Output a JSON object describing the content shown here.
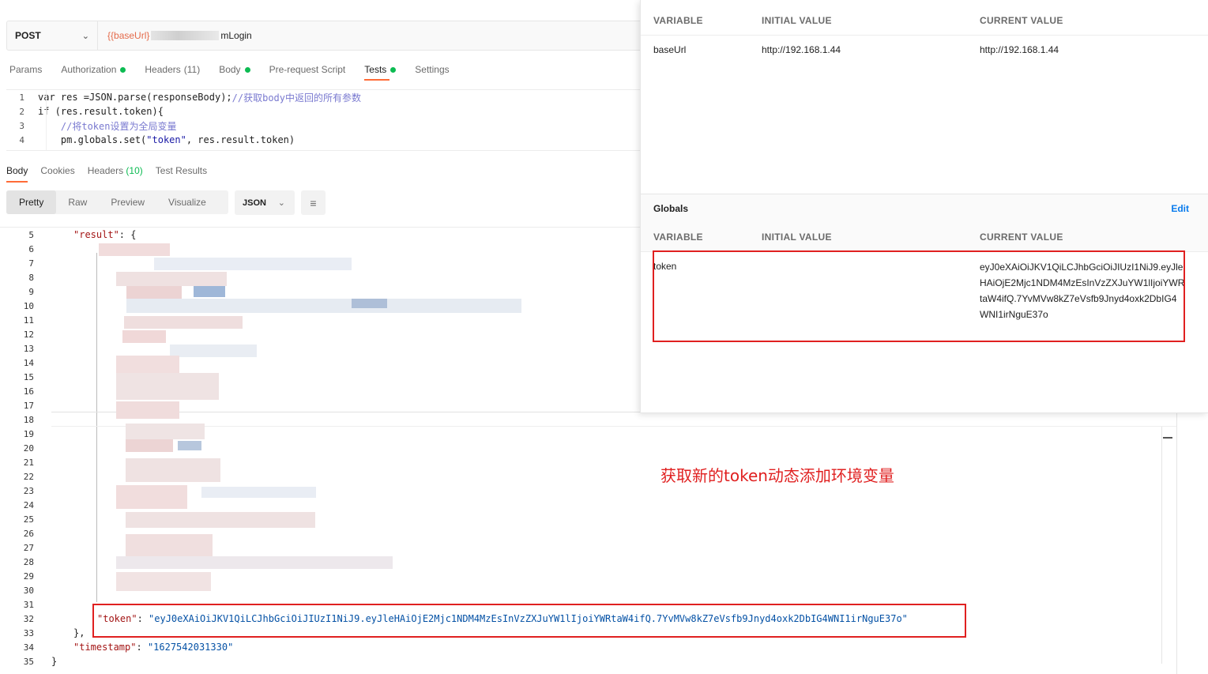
{
  "request": {
    "method": "POST",
    "url_var": "{{baseUrl}",
    "url_path": "mLogin"
  },
  "request_tabs": [
    {
      "label": "Params"
    },
    {
      "label": "Authorization"
    },
    {
      "label": "Headers",
      "count": "(11)"
    },
    {
      "label": "Body"
    },
    {
      "label": "Pre-request Script"
    },
    {
      "label": "Tests"
    },
    {
      "label": "Settings"
    }
  ],
  "tests_script": {
    "line_numbers": [
      "1",
      "2",
      "3",
      "4"
    ],
    "line1_a": "var res =JSON.parse(responseBody);",
    "line1_b": "//获取body中返回的所有参数",
    "line2": "if (res.result.token){",
    "line3": "    //将token设置为全局变量",
    "line4_a": "    pm.globals.set(",
    "line4_b": "\"token\"",
    "line4_c": ", res.result.token)"
  },
  "response_tabs": [
    {
      "label": "Body"
    },
    {
      "label": "Cookies"
    },
    {
      "label": "Headers",
      "count": "(10)"
    },
    {
      "label": "Test Results"
    }
  ],
  "view_modes": [
    "Pretty",
    "Raw",
    "Preview",
    "Visualize"
  ],
  "format": "JSON",
  "response_body": {
    "line_numbers": [
      "5",
      "6",
      "7",
      "8",
      "9",
      "10",
      "11",
      "12",
      "13",
      "14",
      "15",
      "16",
      "17",
      "18",
      "19",
      "20",
      "21",
      "22",
      "23",
      "24",
      "25",
      "26",
      "27",
      "28",
      "29",
      "30",
      "31",
      "32",
      "33",
      "34",
      "35"
    ],
    "result_key": "\"result\"",
    "result_open": ": {",
    "token_key": "\"token\"",
    "token_sep": ": ",
    "token_value": "\"eyJ0eXAiOiJKV1QiLCJhbGciOiJIUzI1NiJ9.eyJleHAiOjE2Mjc1NDM4MzEsInVzZXJuYW1lIjoiYWRtaW4ifQ.7YvMVw8kZ7eVsfb9Jnyd4oxk2DbIG4WNI1irNguE37o\"",
    "close_result": "},",
    "timestamp_key": "\"timestamp\"",
    "timestamp_sep": ": ",
    "timestamp_value": "\"1627542031330\"",
    "close_root": "}"
  },
  "environment": {
    "headers": {
      "variable": "VARIABLE",
      "initial": "INITIAL VALUE",
      "current": "CURRENT VALUE"
    },
    "rows": [
      {
        "variable": "baseUrl",
        "initial": "http://192.168.1.44",
        "current": "http://192.168.1.44"
      }
    ]
  },
  "globals": {
    "title": "Globals",
    "edit_label": "Edit",
    "headers": {
      "variable": "VARIABLE",
      "initial": "INITIAL VALUE",
      "current": "CURRENT VALUE"
    },
    "rows": [
      {
        "variable": "token",
        "initial": "",
        "current": "eyJ0eXAiOiJKV1QiLCJhbGciOiJIUzI1NiJ9.eyJleHAiOjE2Mjc1NDM4MzEsInVzZXJuYW1lIjoiYWRtaW4ifQ.7YvMVw8kZ7eVsfb9Jnyd4oxk2DbIG4WNI1irNguE37o"
      }
    ]
  },
  "annotation": "获取新的token动态添加环境变量",
  "colors": {
    "accent": "#ff6c37",
    "status_dot": "#0cbb52",
    "annotation": "#e02020",
    "link": "#097bed"
  }
}
